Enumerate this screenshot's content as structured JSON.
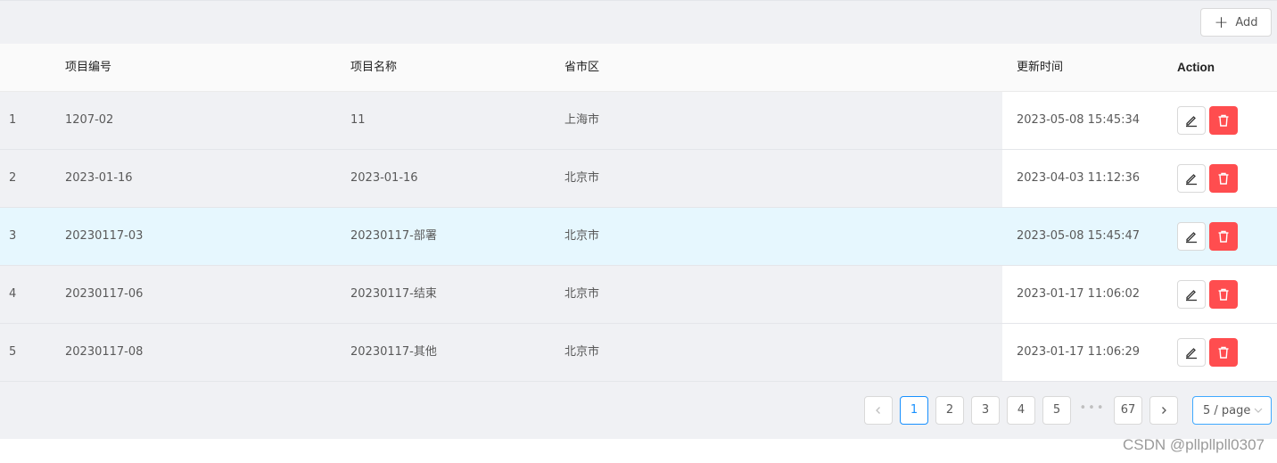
{
  "toolbar": {
    "add_label": "Add",
    "add_icon": "plus-icon"
  },
  "table": {
    "headers": {
      "index": "",
      "code": "项目编号",
      "name": "项目名称",
      "region": "省市区",
      "updated": "更新时间",
      "action": "Action"
    },
    "rows": [
      {
        "index": "1",
        "code": "1207-02",
        "name": "11",
        "region": "上海市",
        "updated": "2023-05-08 15:45:34"
      },
      {
        "index": "2",
        "code": "2023-01-16",
        "name": "2023-01-16",
        "region": "北京市",
        "updated": "2023-04-03 11:12:36"
      },
      {
        "index": "3",
        "code": "20230117-03",
        "name": "20230117-部署",
        "region": "北京市",
        "updated": "2023-05-08 15:45:47"
      },
      {
        "index": "4",
        "code": "20230117-06",
        "name": "20230117-结束",
        "region": "北京市",
        "updated": "2023-01-17 11:06:02"
      },
      {
        "index": "5",
        "code": "20230117-08",
        "name": "20230117-其他",
        "region": "北京市",
        "updated": "2023-01-17 11:06:29"
      }
    ],
    "row_actions": {
      "edit_icon": "edit-icon",
      "delete_icon": "trash-icon"
    },
    "highlighted_row": 3
  },
  "pagination": {
    "prev_icon": "chevron-left-icon",
    "pages": [
      "1",
      "2",
      "3",
      "4",
      "5"
    ],
    "ellipsis": "•••",
    "last_page": "67",
    "next_icon": "chevron-right-icon",
    "current_page": "1",
    "page_size": "5 / page"
  },
  "colors": {
    "accent": "#1890ff",
    "danger": "#ff4d4f",
    "row_bg": "#f0f1f4",
    "row_highlight": "#e6f7fe"
  },
  "watermark": "CSDN @pllpllpll0307"
}
